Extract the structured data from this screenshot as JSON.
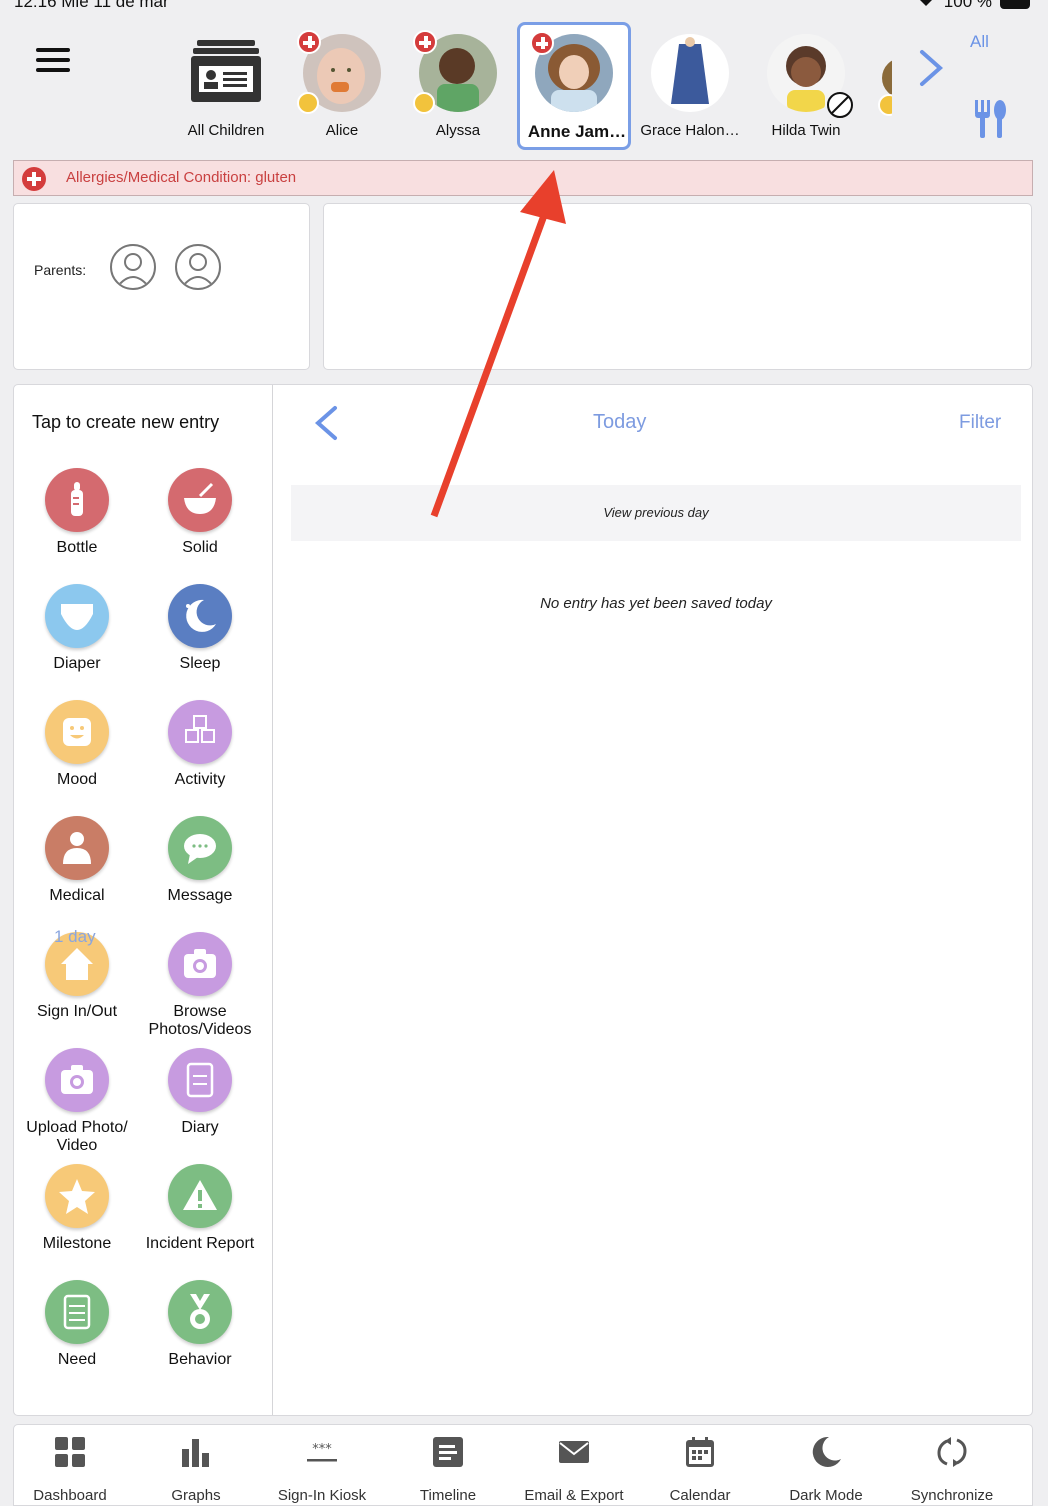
{
  "status_bar": {
    "time": "12:16  Mié 11 de mar",
    "battery": "100 %"
  },
  "header": {
    "menu_icon": "hamburger-icon",
    "children": [
      {
        "name": "All Children",
        "icon": "roster-icon"
      },
      {
        "name": "Alice",
        "badges": [
          "medical",
          "star"
        ]
      },
      {
        "name": "Alyssa",
        "badges": [
          "medical",
          "star"
        ]
      },
      {
        "name": "Anne Jam…",
        "badges": [
          "medical"
        ],
        "selected": true
      },
      {
        "name": "Grace Halon…",
        "badges": []
      },
      {
        "name": "Hilda Twin",
        "badges": [
          "no-photo"
        ]
      }
    ],
    "all_label": "All"
  },
  "allergy_banner": {
    "text": "Allergies/Medical Condition: gluten"
  },
  "parents": {
    "label": "Parents:"
  },
  "entries": {
    "heading": "Tap to create new entry",
    "items": [
      {
        "label": "Bottle",
        "color": "#d46a6f",
        "icon": "bottle-icon"
      },
      {
        "label": "Solid",
        "color": "#d46a6f",
        "icon": "bowl-icon"
      },
      {
        "label": "Diaper",
        "color": "#8cc8ee",
        "icon": "diaper-icon"
      },
      {
        "label": "Sleep",
        "color": "#5a7ec2",
        "icon": "moon-icon"
      },
      {
        "label": "Mood",
        "color": "#f7c978",
        "icon": "smiley-icon"
      },
      {
        "label": "Activity",
        "color": "#c79be0",
        "icon": "blocks-icon"
      },
      {
        "label": "Medical",
        "color": "#c97d66",
        "icon": "doctor-icon"
      },
      {
        "label": "Message",
        "color": "#7dbd83",
        "icon": "chat-icon"
      },
      {
        "label": "Sign In/Out",
        "color": "#f7c978",
        "icon": "house-icon"
      },
      {
        "label": "Browse Photos/Videos",
        "color": "#c79be0",
        "icon": "camera-icon"
      },
      {
        "label": "Upload Photo/ Video",
        "color": "#c79be0",
        "icon": "camera-icon"
      },
      {
        "label": "Diary",
        "color": "#c79be0",
        "icon": "notebook-icon"
      },
      {
        "label": "Milestone",
        "color": "#f7c978",
        "icon": "star-icon"
      },
      {
        "label": "Incident Report",
        "color": "#7dbd83",
        "icon": "warning-icon"
      },
      {
        "label": "Need",
        "color": "#7dbd83",
        "icon": "checklist-icon"
      },
      {
        "label": "Behavior",
        "color": "#7dbd83",
        "icon": "medal-icon"
      }
    ],
    "sign_in_hint": "1 day"
  },
  "timeline": {
    "date_label": "Today",
    "filter_label": "Filter",
    "previous_day_label": "View previous day",
    "empty_message": "No entry has yet been saved today"
  },
  "tabbar": [
    {
      "label": "Dashboard",
      "icon": "grid-icon"
    },
    {
      "label": "Graphs",
      "icon": "bar-chart-icon"
    },
    {
      "label": "Sign-In Kiosk",
      "icon": "password-icon"
    },
    {
      "label": "Timeline",
      "icon": "document-icon"
    },
    {
      "label": "Email & Export",
      "icon": "envelope-icon"
    },
    {
      "label": "Calendar",
      "icon": "calendar-icon"
    },
    {
      "label": "Dark Mode",
      "icon": "moon-icon"
    },
    {
      "label": "Synchronize",
      "icon": "sync-icon"
    }
  ],
  "colors": {
    "accent": "#7a9ee6",
    "alert": "#d43c3c",
    "annotation": "#e8402c"
  }
}
